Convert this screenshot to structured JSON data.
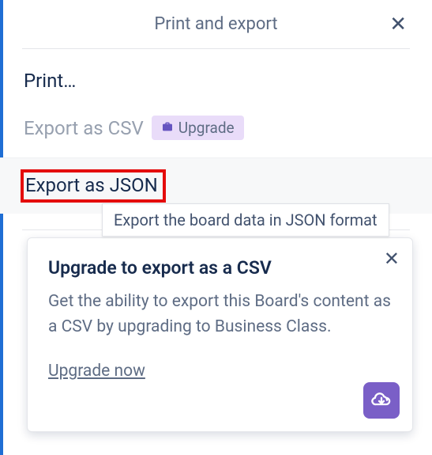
{
  "header": {
    "title": "Print and export"
  },
  "menu": {
    "print": "Print…",
    "exportCsv": "Export as CSV",
    "upgradePill": "Upgrade",
    "exportJson": "Export as JSON"
  },
  "tooltip": "Export the board data in JSON format",
  "card": {
    "title": "Upgrade to export as a CSV",
    "desc": "Get the ability to export this Board's content as a CSV by upgrading to Business Class.",
    "cta": "Upgrade now"
  }
}
